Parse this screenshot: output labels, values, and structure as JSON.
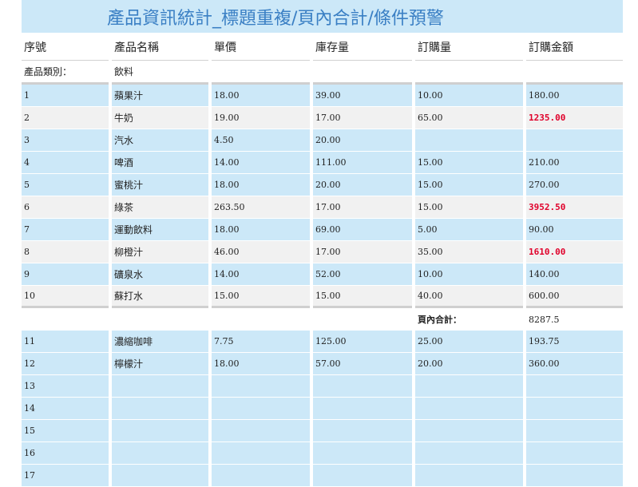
{
  "title": "產品資訊統計_標題重複/頁內合計/條件預警",
  "headers": [
    "序號",
    "產品名稱",
    "單價",
    "庫存量",
    "訂購量",
    "訂購金額"
  ],
  "category": {
    "label": "產品類別：",
    "value": "飲料"
  },
  "highlight_color": "#e0002a",
  "group1": [
    {
      "id": "1",
      "name": "蘋果汁",
      "price": "18.00",
      "stock": "39.00",
      "order": "10.00",
      "amount": "180.00",
      "alert": false,
      "shade": "blue"
    },
    {
      "id": "2",
      "name": "牛奶",
      "price": "19.00",
      "stock": "17.00",
      "order": "65.00",
      "amount": "1235.00",
      "alert": true,
      "shade": "grey"
    },
    {
      "id": "3",
      "name": "汽水",
      "price": "4.50",
      "stock": "20.00",
      "order": "",
      "amount": "",
      "alert": false,
      "shade": "blue"
    },
    {
      "id": "4",
      "name": "啤酒",
      "price": "14.00",
      "stock": "111.00",
      "order": "15.00",
      "amount": "210.00",
      "alert": false,
      "shade": "blue"
    },
    {
      "id": "5",
      "name": "蜜桃汁",
      "price": "18.00",
      "stock": "20.00",
      "order": "15.00",
      "amount": "270.00",
      "alert": false,
      "shade": "blue"
    },
    {
      "id": "6",
      "name": "綠茶",
      "price": "263.50",
      "stock": "17.00",
      "order": "15.00",
      "amount": "3952.50",
      "alert": true,
      "shade": "grey"
    },
    {
      "id": "7",
      "name": "運動飲料",
      "price": "18.00",
      "stock": "69.00",
      "order": "5.00",
      "amount": "90.00",
      "alert": false,
      "shade": "blue"
    },
    {
      "id": "8",
      "name": "柳橙汁",
      "price": "46.00",
      "stock": "17.00",
      "order": "35.00",
      "amount": "1610.00",
      "alert": true,
      "shade": "grey"
    },
    {
      "id": "9",
      "name": "礦泉水",
      "price": "14.00",
      "stock": "52.00",
      "order": "10.00",
      "amount": "140.00",
      "alert": false,
      "shade": "blue"
    },
    {
      "id": "10",
      "name": "蘇打水",
      "price": "15.00",
      "stock": "15.00",
      "order": "40.00",
      "amount": "600.00",
      "alert": false,
      "shade": "grey"
    }
  ],
  "page_total": {
    "label": "頁內合計：",
    "value": "8287.5"
  },
  "group2": [
    {
      "id": "11",
      "name": "濃縮咖啡",
      "price": "7.75",
      "stock": "125.00",
      "order": "25.00",
      "amount": "193.75",
      "alert": false,
      "shade": "blue"
    },
    {
      "id": "12",
      "name": "檸檬汁",
      "price": "18.00",
      "stock": "57.00",
      "order": "20.00",
      "amount": "360.00",
      "alert": false,
      "shade": "blue"
    },
    {
      "id": "13",
      "name": "",
      "price": "",
      "stock": "",
      "order": "",
      "amount": "",
      "alert": false,
      "shade": "blue"
    },
    {
      "id": "14",
      "name": "",
      "price": "",
      "stock": "",
      "order": "",
      "amount": "",
      "alert": false,
      "shade": "blue"
    },
    {
      "id": "15",
      "name": "",
      "price": "",
      "stock": "",
      "order": "",
      "amount": "",
      "alert": false,
      "shade": "blue"
    },
    {
      "id": "16",
      "name": "",
      "price": "",
      "stock": "",
      "order": "",
      "amount": "",
      "alert": false,
      "shade": "blue"
    },
    {
      "id": "17",
      "name": "",
      "price": "",
      "stock": "",
      "order": "",
      "amount": "",
      "alert": false,
      "shade": "blue"
    }
  ]
}
